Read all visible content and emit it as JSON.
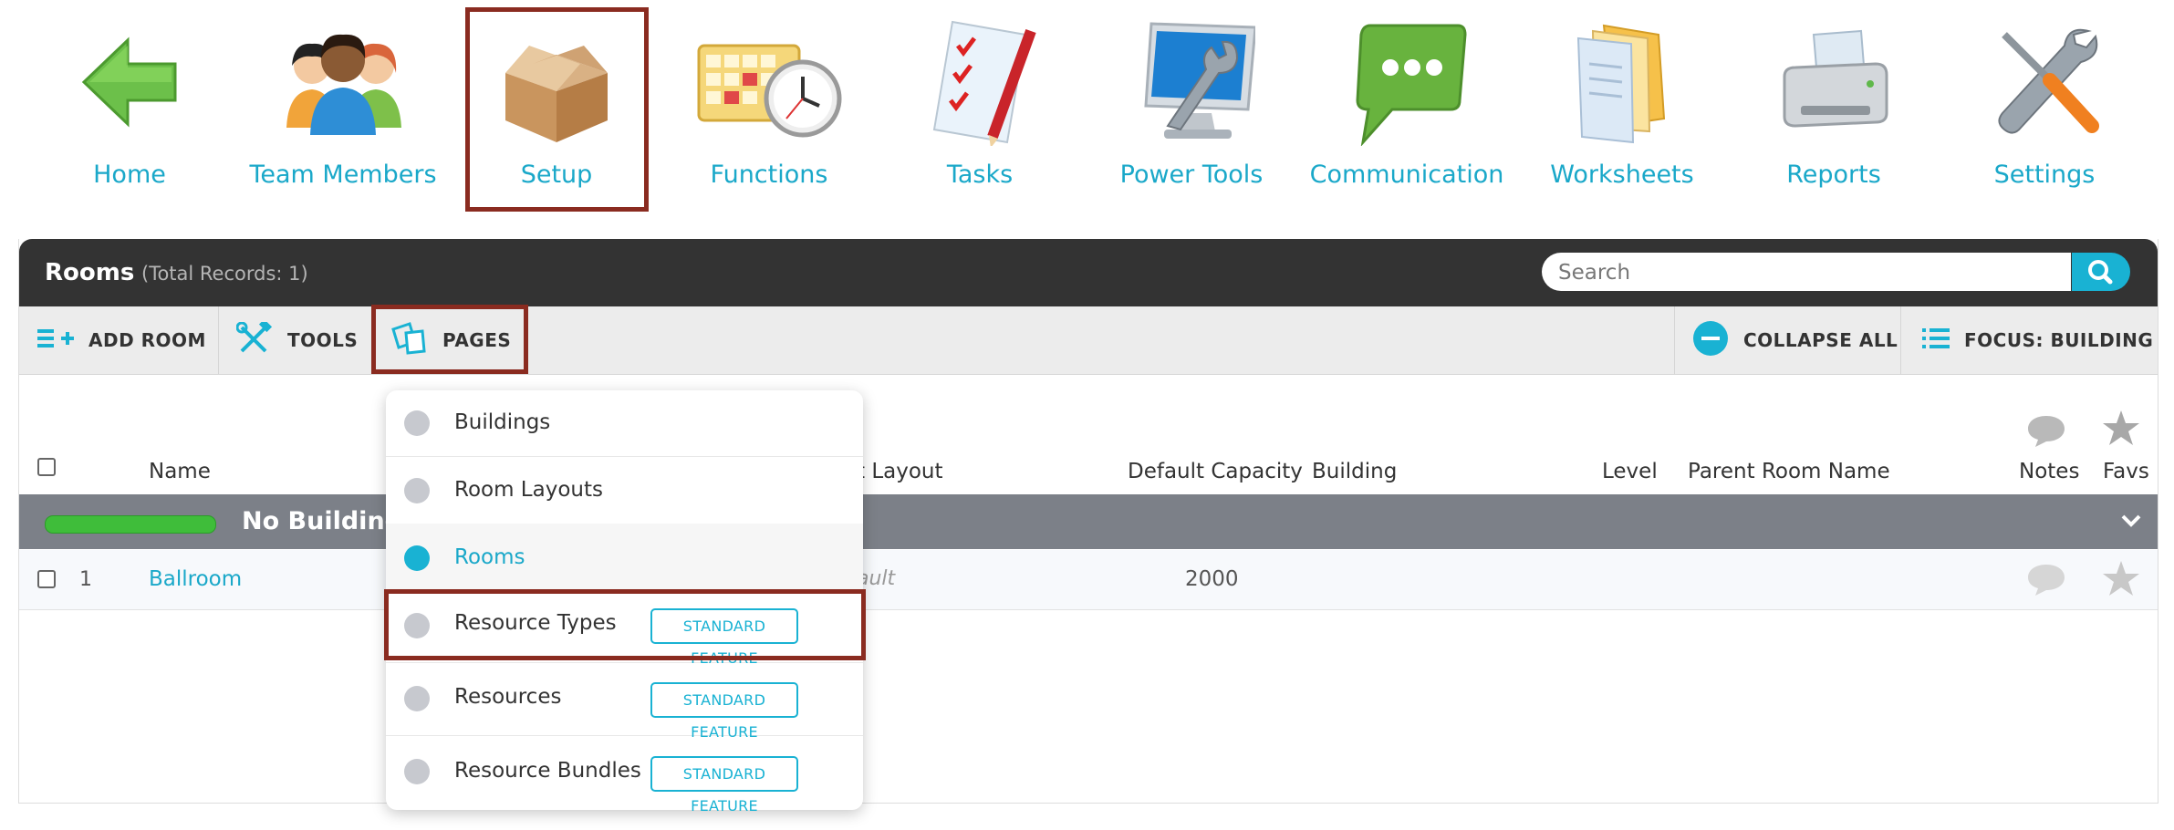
{
  "nav": {
    "items": [
      {
        "label": "Home",
        "icon": "home-arrow-icon"
      },
      {
        "label": "Team Members",
        "icon": "team-members-icon"
      },
      {
        "label": "Setup",
        "icon": "box-icon",
        "selected": true
      },
      {
        "label": "Functions",
        "icon": "calendar-clock-icon"
      },
      {
        "label": "Tasks",
        "icon": "checklist-icon"
      },
      {
        "label": "Power Tools",
        "icon": "monitor-wrench-icon"
      },
      {
        "label": "Communication",
        "icon": "chat-bubble-icon"
      },
      {
        "label": "Worksheets",
        "icon": "documents-icon"
      },
      {
        "label": "Reports",
        "icon": "printer-icon"
      },
      {
        "label": "Settings",
        "icon": "tools-icon"
      }
    ]
  },
  "panel": {
    "title": "Rooms",
    "count": "(Total Records: 1)",
    "search_placeholder": "Search"
  },
  "toolbar": {
    "add_room": "ADD ROOM",
    "tools": "TOOLS",
    "pages": "PAGES",
    "collapse_all": "COLLAPSE ALL",
    "focus": "FOCUS: BUILDING"
  },
  "table": {
    "headers": {
      "name": "Name",
      "layout": "t Layout",
      "capacity": "Default Capacity",
      "building": "Building",
      "level": "Level",
      "parent": "Parent Room Name",
      "notes": "Notes",
      "favs": "Favs"
    },
    "group_label": "No Building A",
    "rows": [
      {
        "index": "1",
        "name": "Ballroom",
        "layout": "ault",
        "capacity": "2000"
      }
    ]
  },
  "dropdown": {
    "items": [
      {
        "label": "Buildings",
        "badge": ""
      },
      {
        "label": "Room Layouts",
        "badge": ""
      },
      {
        "label": "Rooms",
        "badge": "",
        "active": true
      },
      {
        "label": "Resource Types",
        "badge": "STANDARD FEATURE"
      },
      {
        "label": "Resources",
        "badge": "STANDARD FEATURE"
      },
      {
        "label": "Resource Bundles",
        "badge": "STANDARD FEATURE"
      }
    ]
  },
  "colors": {
    "accent": "#19b2d3",
    "highlight": "#8a2b20",
    "header_bg": "#333333",
    "group_bg": "#7c8088",
    "group_bar": "#3fbd3a"
  }
}
